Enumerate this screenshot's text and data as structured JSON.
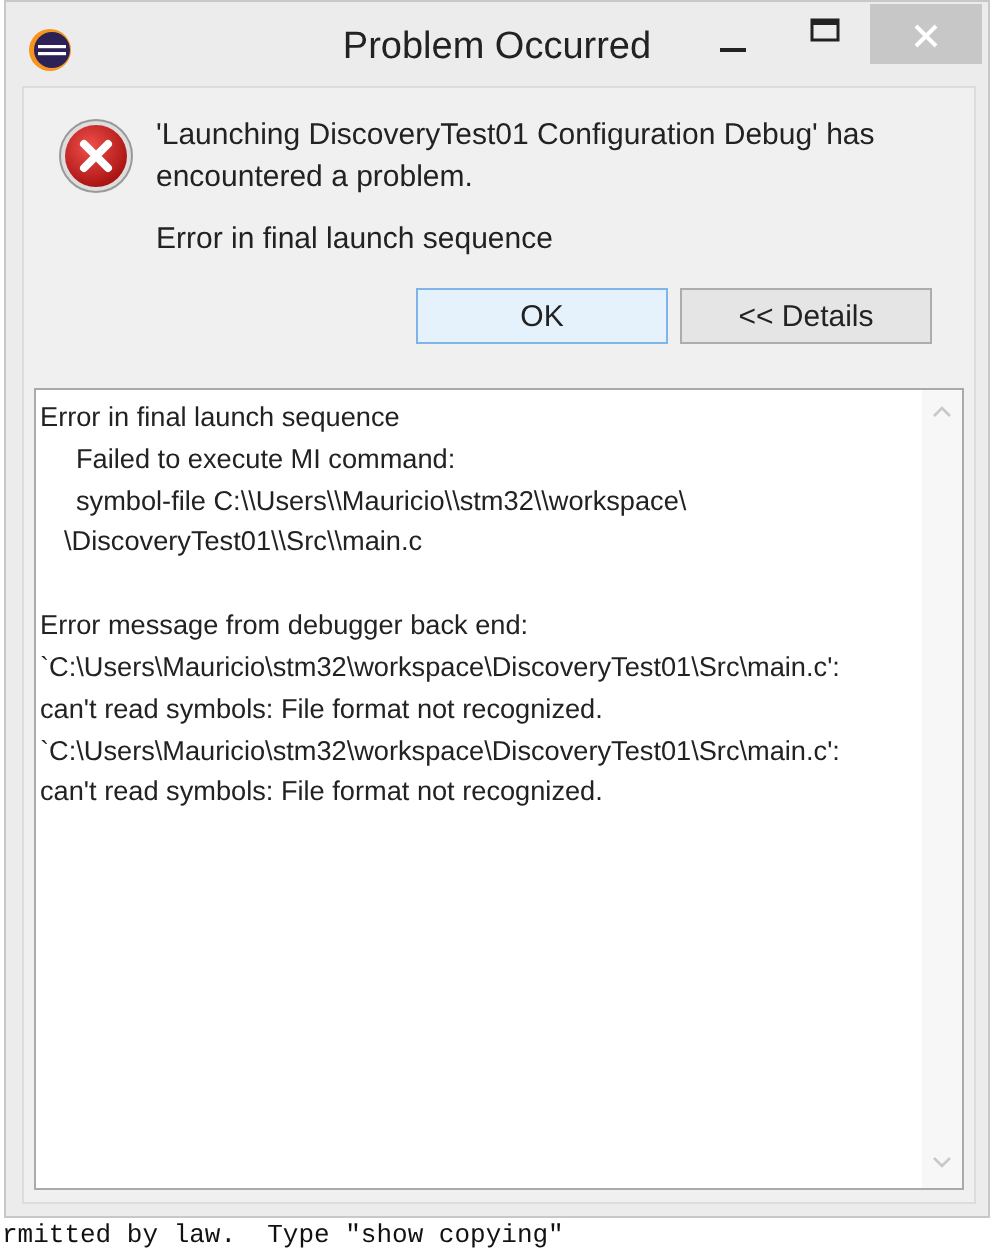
{
  "window": {
    "title": "Problem Occurred"
  },
  "message": {
    "lines": [
      "'Launching DiscoveryTest01 Configuration Debug' has encountered a problem.",
      "Error in final launch sequence"
    ]
  },
  "buttons": [
    {
      "label": "OK",
      "focused": true
    },
    {
      "label": "<< Details",
      "focused": false
    }
  ],
  "details": {
    "groups": [
      {
        "lines": [
          {
            "kind": "top",
            "text": "Error in final launch sequence"
          },
          {
            "kind": "sub",
            "text": "Failed to execute MI command:"
          },
          {
            "kind": "sub",
            "text": "symbol-file C:\\\\Users\\\\Mauricio\\\\stm32\\\\workspace\\"
          },
          {
            "kind": "wrap",
            "text": "\\DiscoveryTest01\\\\Src\\\\main.c"
          }
        ]
      },
      {
        "lines": [
          {
            "kind": "top",
            "text": "Error message from debugger back end:"
          },
          {
            "kind": "top",
            "text": "`C:\\Users\\Mauricio\\stm32\\workspace\\DiscoveryTest01\\Src\\main.c':"
          },
          {
            "kind": "top",
            "text": "can't read symbols: File format not recognized."
          },
          {
            "kind": "top",
            "text": "`C:\\Users\\Mauricio\\stm32\\workspace\\DiscoveryTest01\\Src\\main.c':"
          },
          {
            "kind": "top",
            "text": "can't read symbols: File format not recognized."
          }
        ]
      }
    ]
  },
  "console": {
    "text": "rmitted by law.  Type \"show copying\""
  }
}
